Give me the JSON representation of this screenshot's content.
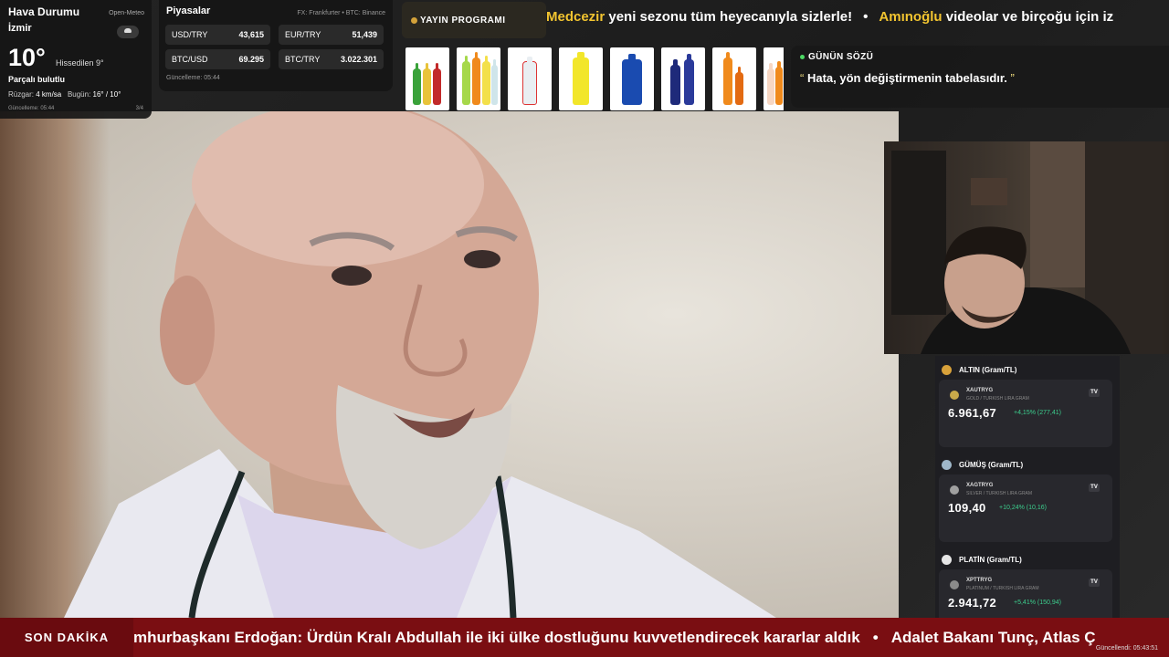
{
  "weather": {
    "title": "Hava Durumu",
    "source": "Open-Meteo",
    "city": "İzmir",
    "temperature": "10°",
    "feels_like": "Hissedilen 9°",
    "condition": "Parçalı bulutlu",
    "wind_label": "Rüzgar:",
    "wind_value": "4 km/sa",
    "today_label": "Bugün:",
    "today_value": "16° / 10°",
    "updated": "Güncelleme: 05:44",
    "page": "3/4",
    "icon": "partly-cloudy-icon"
  },
  "markets": {
    "title": "Piyasalar",
    "source": "FX: Frankfurter • BTC: Binance",
    "rows": [
      {
        "label": "USD/TRY",
        "value": "43,615"
      },
      {
        "label": "EUR/TRY",
        "value": "51,439"
      },
      {
        "label": "BTC/USD",
        "value": "69.295"
      },
      {
        "label": "BTC/TRY",
        "value": "3.022.301"
      }
    ],
    "updated": "Güncelleme: 05:44"
  },
  "program": {
    "badge": "YAYIN PROGRAMI",
    "ticker": [
      {
        "highlight": "Medcezir",
        "text": " yeni sezonu tüm heyecanıyla sizlerle!"
      },
      {
        "highlight": "Amınoğlu",
        "text": " videolar ve birçoğu için iz"
      }
    ],
    "separator": "•"
  },
  "quote": {
    "title": "GÜNÜN SÖZÜ",
    "open_mark": "“",
    "text": "Hata, yön değiştirmenin tabelasıdır.",
    "close_mark": "”"
  },
  "metals": [
    {
      "title": "ALTIN (Gram/TL)",
      "symbol": "XAUTRYG",
      "description": "GOLD / TURKISH LIRA GRAM",
      "price": "6.961,67",
      "change": "+4,15% (277,41)",
      "medal_color": "#d8a13a",
      "coin_color": "#c9a94a"
    },
    {
      "title": "GÜMÜŞ (Gram/TL)",
      "symbol": "XAGTRYG",
      "description": "SILVER / TURKISH LIRA GRAM",
      "price": "109,40",
      "change": "+10,24% (10,16)",
      "medal_color": "#9fb7c9",
      "coin_color": "#a0a0a0"
    },
    {
      "title": "PLATİN (Gram/TL)",
      "symbol": "XPTTRYG",
      "description": "PLATINUM / TURKISH LIRA GRAM",
      "price": "2.941,72",
      "change": "+5,41% (150,94)",
      "medal_color": "#e6e6e6",
      "coin_color": "#8a8a8a"
    }
  ],
  "tradingview_label": "TV",
  "news": {
    "label": "SON DAKİKA",
    "items": [
      "mhurbaşkanı Erdoğan: Ürdün Kralı Abdullah ile iki ülke dostluğunu kuvvetlendirecek kararlar aldık",
      "Adalet Bakanı Tunç, Atlas Ç"
    ],
    "separator": "•",
    "updated": "Güncellendi: 05:43:51"
  },
  "colors": {
    "accent_yellow": "#f2c430",
    "news_red": "#7a0e12",
    "positive_green": "#3ccf8e"
  }
}
